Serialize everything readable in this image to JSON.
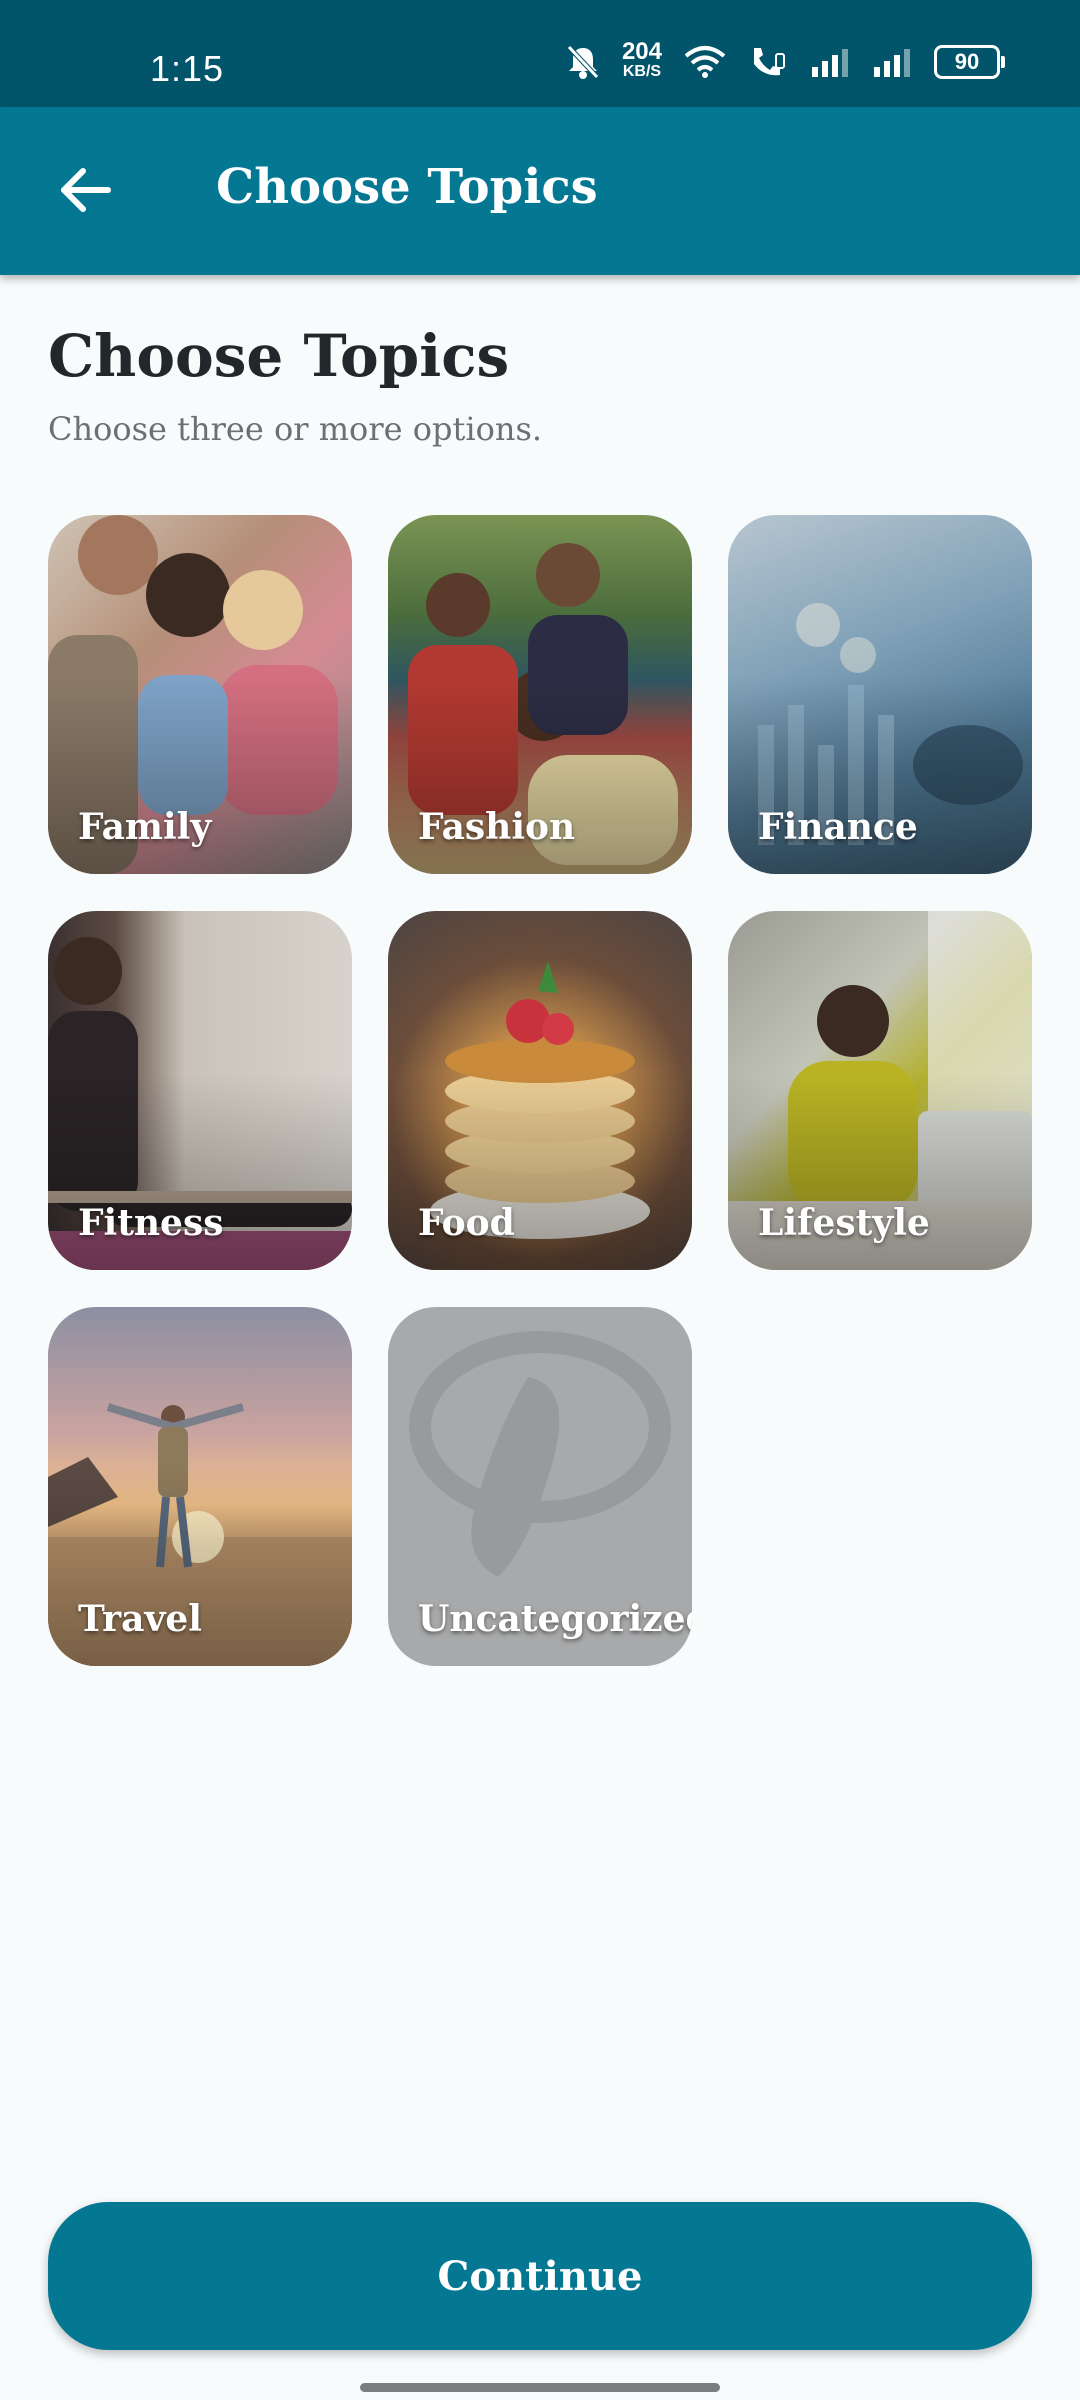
{
  "status_bar": {
    "time": "1:15",
    "net_speed": "204",
    "net_speed_unit": "KB/S",
    "battery": "90"
  },
  "app_bar": {
    "title": "Choose Topics"
  },
  "page": {
    "heading": "Choose Topics",
    "subtitle": "Choose three or more options."
  },
  "topics": [
    {
      "label": "Family",
      "image": "family-photo"
    },
    {
      "label": "Fashion",
      "image": "fashion-photo"
    },
    {
      "label": "Finance",
      "image": "finance-photo"
    },
    {
      "label": "Fitness",
      "image": "fitness-photo"
    },
    {
      "label": "Food",
      "image": "food-photo"
    },
    {
      "label": "Lifestyle",
      "image": "lifestyle-photo"
    },
    {
      "label": "Travel",
      "image": "travel-photo"
    },
    {
      "label": "Uncategorized",
      "image": "placeholder-logo"
    }
  ],
  "continue_label": "Continue",
  "colors": {
    "status_bar": "#015469",
    "app_bar": "#047793",
    "button": "#047793",
    "background": "#f8fbfc"
  }
}
